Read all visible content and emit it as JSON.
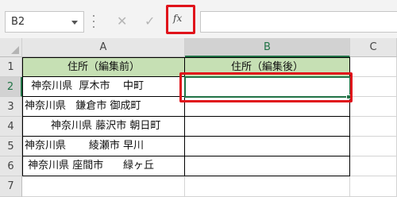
{
  "formula_bar": {
    "name_box": "B2",
    "cancel_icon": "✕",
    "enter_icon": "✓",
    "function_icon": "fx",
    "formula": ""
  },
  "columns": [
    "A",
    "B",
    "C"
  ],
  "rows": [
    "1",
    "2",
    "3",
    "4",
    "5",
    "6",
    "7"
  ],
  "cells": {
    "A1": "住所（編集前）",
    "B1": "住所（編集後）",
    "A2": "  神奈川県  厚木市    中町",
    "A3": "神奈川県   鎌倉市 御成町",
    "A4": "        神奈川県 藤沢市 朝日町",
    "A5": "神奈川県       綾瀬市 早川",
    "A6": " 神奈川県 座間市      緑ヶ丘",
    "B2": "",
    "B3": "",
    "B4": "",
    "B5": "",
    "B6": ""
  },
  "active_cell": "B2",
  "colors": {
    "header_fill": "#c6e0b4",
    "selection": "#217346",
    "highlight": "#e0131b"
  }
}
